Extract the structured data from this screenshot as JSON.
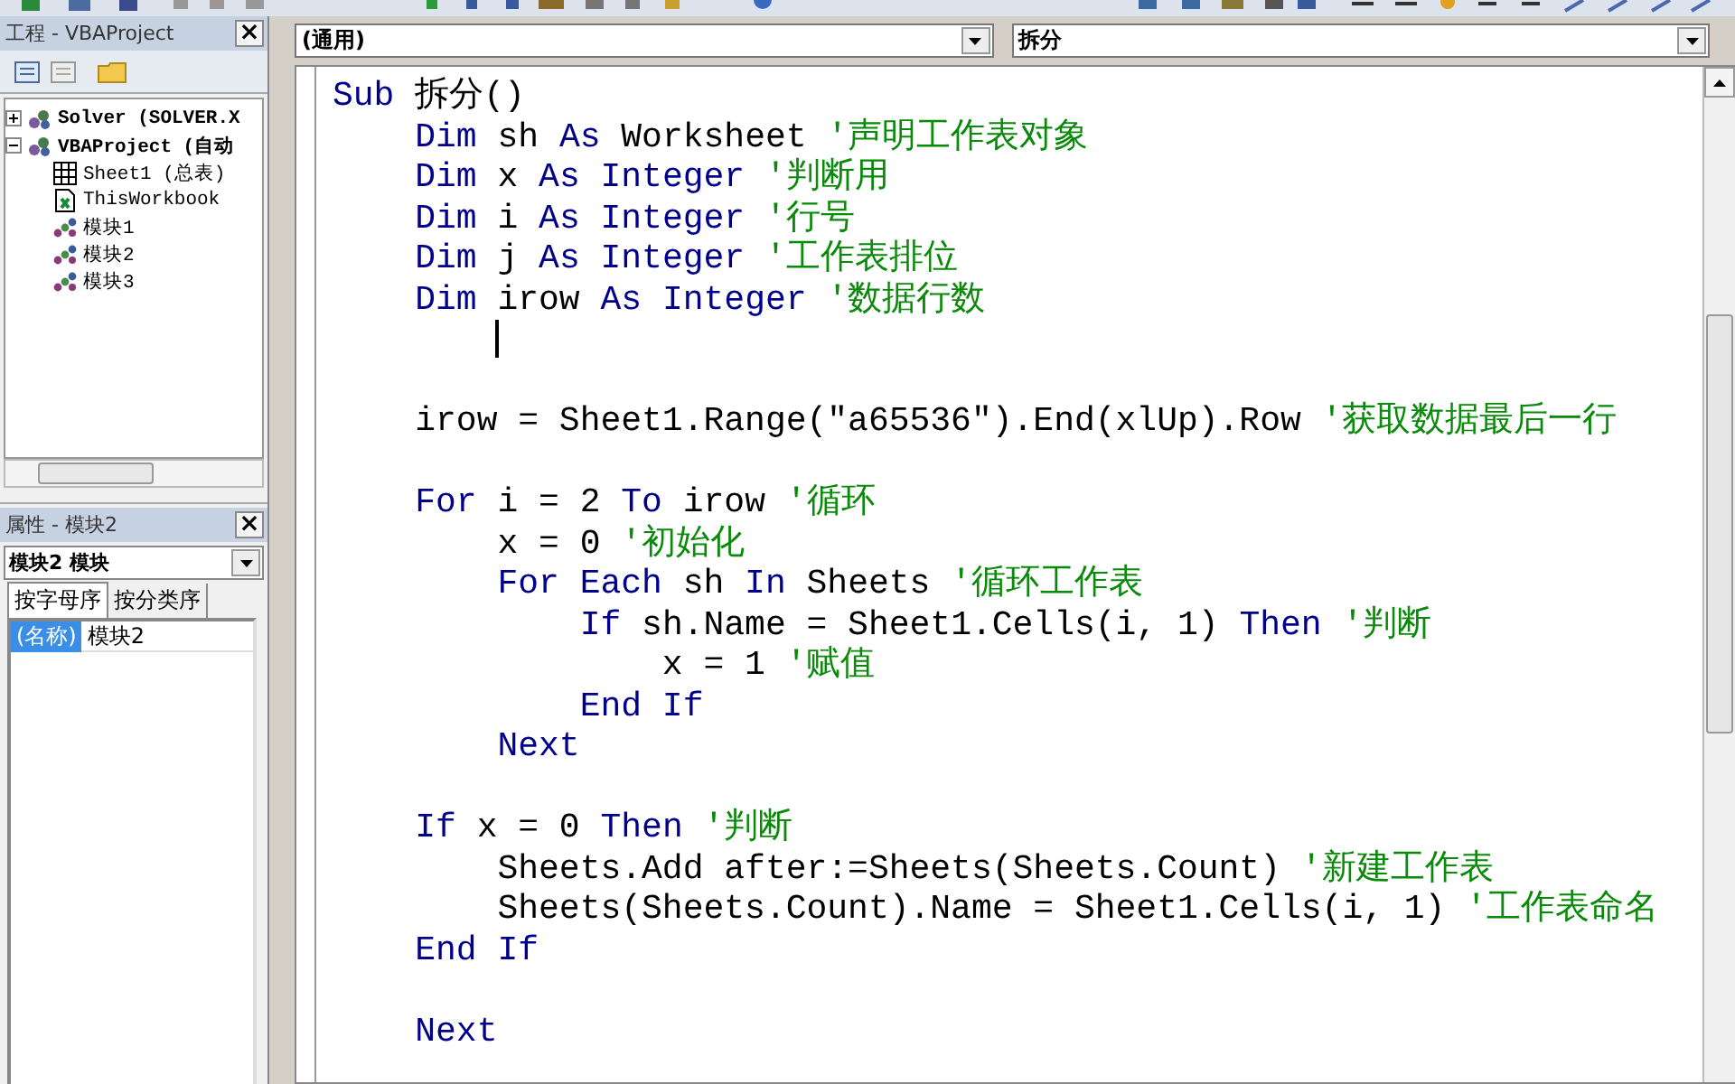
{
  "project_panel": {
    "title": "工程 - VBAProject",
    "close": "×",
    "tree": [
      {
        "label": "Solver (SOLVER.X",
        "kind": "project",
        "expanded": false
      },
      {
        "label": "VBAProject (自动",
        "kind": "project",
        "expanded": true,
        "children": [
          {
            "label": "Sheet1 (总表)",
            "kind": "sheet"
          },
          {
            "label": "ThisWorkbook",
            "kind": "workbook"
          },
          {
            "label": "模块1",
            "kind": "module"
          },
          {
            "label": "模块2",
            "kind": "module"
          },
          {
            "label": "模块3",
            "kind": "module"
          }
        ]
      }
    ]
  },
  "properties_panel": {
    "title": "属性 - 模块2",
    "close": "×",
    "object": "模块2 模块",
    "tabs": [
      {
        "label": "按字母序",
        "selected": true
      },
      {
        "label": "按分类序",
        "selected": false
      }
    ],
    "rows": [
      {
        "name": "(名称)",
        "value": "模块2",
        "selected": true
      }
    ]
  },
  "code_window": {
    "object_dropdown": "(通用)",
    "procedure_dropdown": "拆分",
    "lines": [
      {
        "kind": "code",
        "segments": [
          {
            "kind": "kw",
            "text": "Sub"
          },
          {
            "kind": "plain",
            "text": " 拆分()"
          }
        ]
      },
      {
        "kind": "code",
        "segments": [
          {
            "kind": "kw",
            "text": "    Dim"
          },
          {
            "kind": "plain",
            "text": " sh "
          },
          {
            "kind": "kw",
            "text": "As"
          },
          {
            "kind": "plain",
            "text": " Worksheet "
          },
          {
            "kind": "comment",
            "text": "'声明工作表对象"
          }
        ]
      },
      {
        "kind": "code",
        "segments": [
          {
            "kind": "kw",
            "text": "    Dim"
          },
          {
            "kind": "plain",
            "text": " x "
          },
          {
            "kind": "kw",
            "text": "As Integer "
          },
          {
            "kind": "comment",
            "text": "'判断用"
          }
        ]
      },
      {
        "kind": "code",
        "segments": [
          {
            "kind": "kw",
            "text": "    Dim"
          },
          {
            "kind": "plain",
            "text": " i "
          },
          {
            "kind": "kw",
            "text": "As Integer "
          },
          {
            "kind": "comment",
            "text": "'行号"
          }
        ]
      },
      {
        "kind": "code",
        "segments": [
          {
            "kind": "kw",
            "text": "    Dim"
          },
          {
            "kind": "plain",
            "text": " j "
          },
          {
            "kind": "kw",
            "text": "As Integer "
          },
          {
            "kind": "comment",
            "text": "'工作表排位"
          }
        ]
      },
      {
        "kind": "code",
        "segments": [
          {
            "kind": "kw",
            "text": "    Dim"
          },
          {
            "kind": "plain",
            "text": " irow "
          },
          {
            "kind": "kw",
            "text": "As Integer "
          },
          {
            "kind": "comment",
            "text": "'数据行数"
          }
        ]
      },
      {
        "kind": "cursor"
      },
      {
        "kind": "blank"
      },
      {
        "kind": "code",
        "segments": [
          {
            "kind": "plain",
            "text": "    irow = Sheet1.Range(\"a65536\").End(xlUp).Row "
          },
          {
            "kind": "comment",
            "text": "'获取数据最后一行"
          }
        ]
      },
      {
        "kind": "blank"
      },
      {
        "kind": "code",
        "segments": [
          {
            "kind": "kw",
            "text": "    For"
          },
          {
            "kind": "plain",
            "text": " i = 2 "
          },
          {
            "kind": "kw",
            "text": "To"
          },
          {
            "kind": "plain",
            "text": " irow "
          },
          {
            "kind": "comment",
            "text": "'循环"
          }
        ]
      },
      {
        "kind": "code",
        "segments": [
          {
            "kind": "plain",
            "text": "        x = 0 "
          },
          {
            "kind": "comment",
            "text": "'初始化"
          }
        ]
      },
      {
        "kind": "code",
        "segments": [
          {
            "kind": "kw",
            "text": "        For Each"
          },
          {
            "kind": "plain",
            "text": " sh "
          },
          {
            "kind": "kw",
            "text": "In"
          },
          {
            "kind": "plain",
            "text": " Sheets "
          },
          {
            "kind": "comment",
            "text": "'循环工作表"
          }
        ]
      },
      {
        "kind": "code",
        "segments": [
          {
            "kind": "kw",
            "text": "            If"
          },
          {
            "kind": "plain",
            "text": " sh.Name = Sheet1.Cells(i, 1) "
          },
          {
            "kind": "kw",
            "text": "Then "
          },
          {
            "kind": "comment",
            "text": "'判断"
          }
        ]
      },
      {
        "kind": "code",
        "segments": [
          {
            "kind": "plain",
            "text": "                x = 1 "
          },
          {
            "kind": "comment",
            "text": "'赋值"
          }
        ]
      },
      {
        "kind": "code",
        "segments": [
          {
            "kind": "kw",
            "text": "            End If"
          }
        ]
      },
      {
        "kind": "code",
        "segments": [
          {
            "kind": "kw",
            "text": "        Next"
          }
        ]
      },
      {
        "kind": "blank"
      },
      {
        "kind": "code",
        "segments": [
          {
            "kind": "kw",
            "text": "    If"
          },
          {
            "kind": "plain",
            "text": " x = 0 "
          },
          {
            "kind": "kw",
            "text": "Then "
          },
          {
            "kind": "comment",
            "text": "'判断"
          }
        ]
      },
      {
        "kind": "code",
        "segments": [
          {
            "kind": "plain",
            "text": "        Sheets.Add after:=Sheets(Sheets.Count) "
          },
          {
            "kind": "comment",
            "text": "'新建工作表"
          }
        ]
      },
      {
        "kind": "code",
        "segments": [
          {
            "kind": "plain",
            "text": "        Sheets(Sheets.Count).Name = Sheet1.Cells(i, 1) "
          },
          {
            "kind": "comment",
            "text": "'工作表命名"
          }
        ]
      },
      {
        "kind": "code",
        "segments": [
          {
            "kind": "kw",
            "text": "    End If"
          }
        ]
      },
      {
        "kind": "blank"
      },
      {
        "kind": "code",
        "segments": [
          {
            "kind": "kw",
            "text": "    Next"
          }
        ]
      }
    ]
  }
}
